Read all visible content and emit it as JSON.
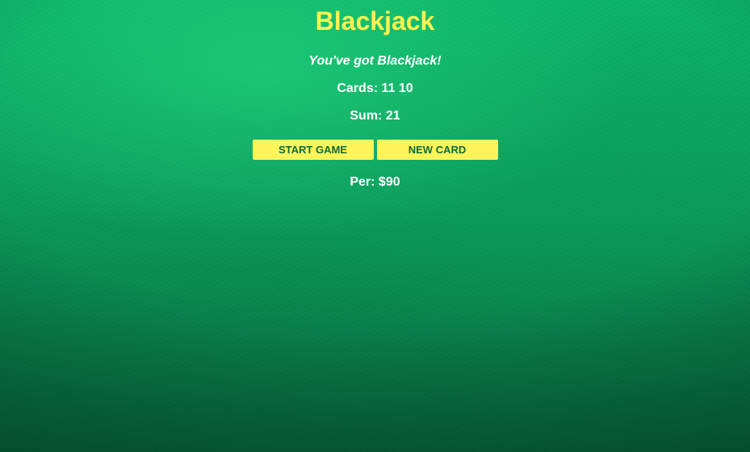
{
  "game": {
    "title": "Blackjack",
    "message": "You've got Blackjack!",
    "cards_text": "Cards: 11 10",
    "sum_text": "Sum: 21",
    "player_text": "Per: $90"
  },
  "buttons": {
    "start_label": "START GAME",
    "new_card_label": "NEW CARD"
  },
  "colors": {
    "title": "#fff34f",
    "button_bg": "#fff55a",
    "button_text": "#0d6b3a",
    "text": "#ffffff",
    "felt": "#0a8a52"
  }
}
